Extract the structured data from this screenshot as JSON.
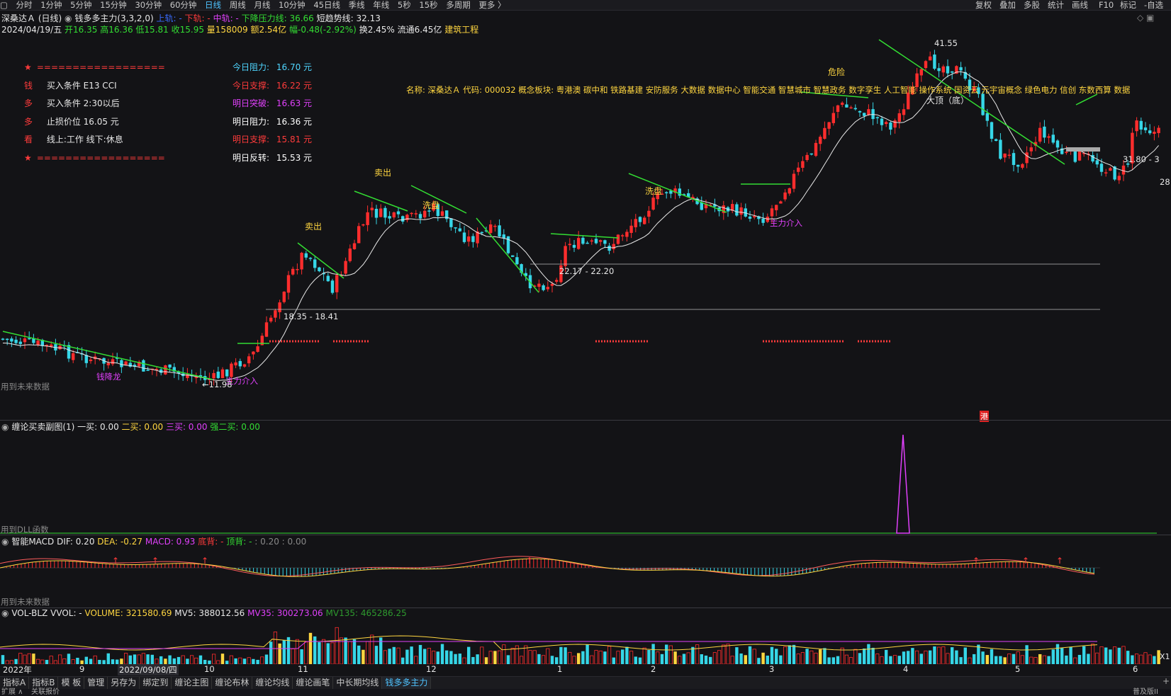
{
  "toolbar": {
    "periods": [
      "分时",
      "1分钟",
      "5分钟",
      "15分钟",
      "30分钟",
      "60分钟",
      "日线",
      "周线",
      "月线",
      "10分钟",
      "45日线",
      "季线",
      "年线",
      "5秒",
      "15秒",
      "多周期",
      "更多 〉"
    ],
    "active_period": "日线",
    "right_buttons": [
      "复权",
      "叠加",
      "多股",
      "统计",
      "画线",
      "F10",
      "标记",
      "-自选"
    ]
  },
  "header": {
    "stock_title": "深桑达Ａ (日线)",
    "indicator_name": "钱多多主力(3,3,2,0)",
    "upper_label": "上轨: -",
    "lower_label": "下轨: -",
    "mid_label": "中轨: -",
    "pressure_label": "下降压力线: 36.66",
    "short_trend_label": "短趋势线: 32.13",
    "date": "2024/04/19/五",
    "open": "开16.35",
    "high": "高16.36",
    "low": "低15.81",
    "close": "收15.95",
    "volume": "量158009",
    "amount": "额2.54亿",
    "change": "幅-0.48(-2.92%)",
    "turnover": "换2.45%",
    "float_cap": "流通6.45亿",
    "industry": "建筑工程"
  },
  "signals_panel": {
    "rows": [
      {
        "tag": "★",
        "text": "=================="
      },
      {
        "tag": "钱",
        "text": "买入条件 E13 CCI"
      },
      {
        "tag": "多",
        "text": "买入条件 2:30以后"
      },
      {
        "tag": "多",
        "text": "止损价位 16.05 元"
      },
      {
        "tag": "看",
        "text": "线上:工作 线下:休息"
      },
      {
        "tag": "★",
        "text": "=================="
      }
    ]
  },
  "levels_panel": {
    "rows": [
      {
        "label": "今日阻力:",
        "value": "16.70 元",
        "color": "#4fd6ff"
      },
      {
        "label": "今日支撑:",
        "value": "16.22 元",
        "color": "#ff3b3b"
      },
      {
        "label": "明日突破:",
        "value": "16.63 元",
        "color": "#e040fb"
      },
      {
        "label": "明日阻力:",
        "value": "16.36 元",
        "color": "#ffffff"
      },
      {
        "label": "明日支撑:",
        "value": "15.81 元",
        "color": "#ff3b3b"
      },
      {
        "label": "明日反转:",
        "value": "15.53 元",
        "color": "#ffffff"
      }
    ]
  },
  "stock_info_line": "名称: 深桑达Ａ  代码: 000032  概念板块: 粤港澳  碳中和  铁路基建  安防服务  大数据  数据中心  智能交通  智慧城市  智慧政务  数字孪生  人工智能  操作系统  国资云  元宇宙概念  绿色电力  信创  东数西算  数据",
  "chart_annotations": {
    "sell1": "卖出",
    "sell2": "卖出",
    "wash1": "洗盘",
    "wash2": "洗盘",
    "danger": "危险",
    "main_in1": "主力介入",
    "main_in2": "主力介入",
    "money_dragon": "钱降龙",
    "top_bottom": "大顶（底）",
    "peak_price": "41.55",
    "low_price": "←11.98",
    "range1": "18.35 - 18.41",
    "range2": "22.17 - 22.20",
    "right_price": "31.80 - 3",
    "right_axis_price": "28",
    "future_data1": "用到未来数据",
    "hk_badge": "港"
  },
  "sub1": {
    "title": "缠论买卖副图(1)",
    "buy1": "一买: 0.00",
    "buy2": "二买: 0.00",
    "buy3": "三买: 0.00",
    "strong2": "强二买: 0.00",
    "dll_note": "用到DLL函数"
  },
  "macd": {
    "title": "智能MACD",
    "dif": "DIF: 0.20",
    "dea": "DEA: -0.27",
    "macd": "MACD: 0.93",
    "div_bottom": "底背: -",
    "div_top": "顶背: -",
    "tail": ": 0.20 : 0.00",
    "future_data": "用到未来数据"
  },
  "vol": {
    "title": "VOL-BLZ",
    "vvol": "VVOL: -",
    "volume": "VOLUME: 321580.69",
    "mv5": "MV5: 388012.56",
    "mv35": "MV35: 300273.06",
    "mv135": "MV135: 465286.25",
    "right_label": "X1"
  },
  "time_axis": [
    "2022年",
    "9",
    "2022/09/08/四",
    "10",
    "11",
    "12",
    "1",
    "2",
    "3",
    "4",
    "5",
    "6"
  ],
  "bottom_tabs": [
    "指标A",
    "指标B",
    "模 板",
    "管理",
    "另存为",
    "绑定到",
    "缠论主图",
    "缠论布林",
    "缠论均线",
    "缠论画笔",
    "中长期均线",
    "钱多多主力"
  ],
  "selected_tab": "钱多多主力",
  "status": {
    "left": "扩展 ∧",
    "mid": "关联报价",
    "right": "普及版II"
  },
  "colors": {
    "up": "#ff2d2d",
    "down": "#36d6e7",
    "green_line": "#33dd33",
    "ma_line": "#e8e8e8",
    "yellow": "#ffd640",
    "magenta": "#e040fb"
  }
}
